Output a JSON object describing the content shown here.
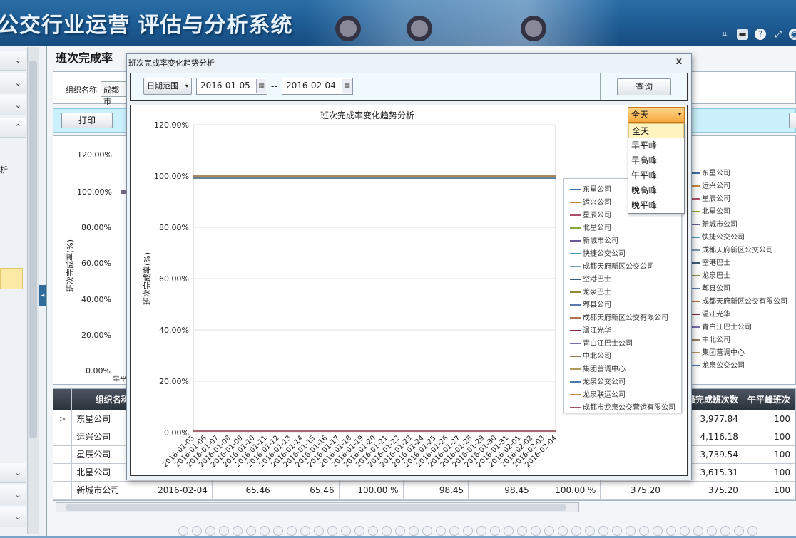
{
  "app": {
    "title": "公交行业运营 评估与分析系统"
  },
  "toolbar": {
    "icons": [
      "crop-icon",
      "window-icon",
      "help-icon",
      "resize-icon",
      "power-icon"
    ],
    "icon_glyphs": [
      "⌗",
      "▬",
      "?",
      "⤢",
      "◉"
    ]
  },
  "sidebar": {
    "partial_label": "析",
    "chev_down": "⌄",
    "chev_up": "⌃"
  },
  "page": {
    "title": "班次完成率"
  },
  "filter": {
    "org_label": "组织名称",
    "org_value": "成都市"
  },
  "actions": {
    "print_label": "打印"
  },
  "bg_chart": {
    "ylabel": "班次完成率(%)",
    "yticks": [
      "120.00%",
      "100.00%",
      "80.00%",
      "60.00%",
      "40.00%",
      "20.00%",
      "0.00%"
    ],
    "xtick": "早平"
  },
  "bg_legend": [
    "东星公司",
    "运兴公司",
    "星辰公司",
    "北星公司",
    "新城市公司",
    "快捷公交公司",
    "成都天府新区公交公司",
    "空港巴士",
    "龙泉巴士",
    "郫县公司",
    "成都天府新区公交有限公司",
    "温江光华",
    "青白江巴士公司",
    "中北公司",
    "集团营调中心",
    "龙泉公交公司"
  ],
  "table": {
    "headers": [
      "组织名称",
      "",
      "",
      "",
      "",
      "",
      "",
      "",
      "午平峰完成班次数",
      "午平峰班次"
    ],
    "rows": [
      {
        "marker": ">",
        "org": "东星公司",
        "date": "",
        "c1": "",
        "c2": "",
        "c3": "",
        "c4": "",
        "c5": "",
        "c6": "",
        "c7": "3,977.84",
        "c8": "100"
      },
      {
        "marker": "",
        "org": "运兴公司",
        "date": "",
        "c1": "",
        "c2": "",
        "c3": "",
        "c4": "",
        "c5": "",
        "c6": "",
        "c7": "4,116.18",
        "c8": "100"
      },
      {
        "marker": "",
        "org": "星辰公司",
        "date": "",
        "c1": "",
        "c2": "",
        "c3": "",
        "c4": "",
        "c5": "",
        "c6": "",
        "c7": "3,739.54",
        "c8": "100"
      },
      {
        "marker": "",
        "org": "北星公司",
        "date": "",
        "c1": "",
        "c2": "",
        "c3": "",
        "c4": "",
        "c5": "",
        "c6": "",
        "c7": "3,615.31",
        "c8": "100"
      },
      {
        "marker": "",
        "org": "新城市公司",
        "date": "2016-02-04",
        "c1": "65.46",
        "c2": "65.46",
        "c3": "100.00 %",
        "c4": "98.45",
        "c5": "98.45",
        "c6": "100.00 %",
        "c7": "375.20",
        "c8": "375.20",
        "c9": "100"
      }
    ]
  },
  "modal": {
    "title": "班次完成率变化趋势分析",
    "close": "x",
    "range_label": "日期范围",
    "start_date": "2016-01-05",
    "sep": "--",
    "end_date": "2016-02-04",
    "query_label": "查询",
    "period_selected": "全天",
    "period_options": [
      "全天",
      "早平峰",
      "早高峰",
      "午平峰",
      "晚高峰",
      "晚平峰"
    ]
  },
  "chart_data": {
    "type": "line",
    "title": "班次完成率变化趋势分析",
    "ylabel": "班次完成率(%)",
    "xlabel": "",
    "ylim": [
      0,
      120
    ],
    "yticks": [
      "120.00%",
      "100.00%",
      "80.00%",
      "60.00%",
      "40.00%",
      "20.00%",
      "0.00%"
    ],
    "categories": [
      "2016-01-05",
      "2016-01-06",
      "2016-01-07",
      "2016-01-08",
      "2016-01-09",
      "2016-01-10",
      "2016-01-11",
      "2016-01-12",
      "2016-01-13",
      "2016-01-14",
      "2016-01-15",
      "2016-01-16",
      "2016-01-17",
      "2016-01-18",
      "2016-01-19",
      "2016-01-20",
      "2016-01-21",
      "2016-01-22",
      "2016-01-23",
      "2016-01-24",
      "2016-01-25",
      "2016-01-26",
      "2016-01-27",
      "2016-01-28",
      "2016-01-29",
      "2016-01-30",
      "2016-01-31",
      "2016-02-01",
      "2016-02-02",
      "2016-02-03",
      "2016-02-04"
    ],
    "legend": "right",
    "series": [
      {
        "name": "东星公司",
        "color": "#3b6ea5",
        "value": 100
      },
      {
        "name": "运兴公司",
        "color": "#c08a3e",
        "value": 100
      },
      {
        "name": "星辰公司",
        "color": "#b0506a",
        "value": 100
      },
      {
        "name": "北星公司",
        "color": "#8aa83a",
        "value": 100
      },
      {
        "name": "新城市公司",
        "color": "#6a5a9a",
        "value": 100
      },
      {
        "name": "快捷公交公司",
        "color": "#4a98b4",
        "value": 100
      },
      {
        "name": "成都天府新区公交公司",
        "color": "#7a9ab8",
        "value": 100
      },
      {
        "name": "空港巴士",
        "color": "#3a5a7a",
        "value": 100
      },
      {
        "name": "龙泉巴士",
        "color": "#8a8a3a",
        "value": 100
      },
      {
        "name": "郫县公司",
        "color": "#5a7ab0",
        "value": 100
      },
      {
        "name": "成都天府新区公交有限公司",
        "color": "#b0704a",
        "value": 100
      },
      {
        "name": "温江光华",
        "color": "#7a2a3a",
        "value": 0
      },
      {
        "name": "青白江巴士公司",
        "color": "#7a6ab0",
        "value": 100
      },
      {
        "name": "中北公司",
        "color": "#9a7a5a",
        "value": 100
      },
      {
        "name": "集团营调中心",
        "color": "#b09a5a",
        "value": 100
      },
      {
        "name": "龙泉公交公司",
        "color": "#4a7aa8",
        "value": 100
      },
      {
        "name": "龙泉联运公司",
        "color": "#c0904a",
        "value": 100
      },
      {
        "name": "成都市龙泉公交营运有限公司",
        "color": "#a05060",
        "value": 0
      }
    ]
  }
}
